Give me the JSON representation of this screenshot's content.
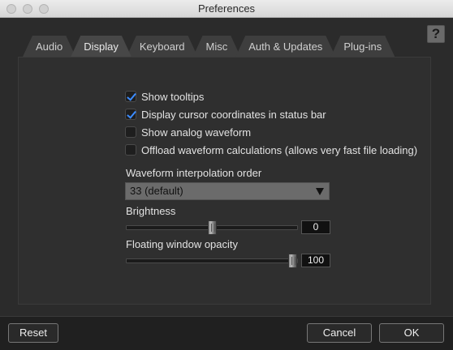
{
  "window": {
    "title": "Preferences"
  },
  "help": {
    "label": "?"
  },
  "tabs": [
    {
      "label": "Audio"
    },
    {
      "label": "Display"
    },
    {
      "label": "Keyboard"
    },
    {
      "label": "Misc"
    },
    {
      "label": "Auth & Updates"
    },
    {
      "label": "Plug-ins"
    }
  ],
  "active_tab": "Display",
  "display": {
    "checkboxes": [
      {
        "label": "Show tooltips",
        "checked": true
      },
      {
        "label": "Display cursor coordinates in status bar",
        "checked": true
      },
      {
        "label": "Show analog waveform",
        "checked": false
      },
      {
        "label": "Offload waveform calculations (allows very fast file loading)",
        "checked": false
      }
    ],
    "interpolation": {
      "label": "Waveform interpolation order",
      "value": "33 (default)"
    },
    "brightness": {
      "label": "Brightness",
      "value": "0",
      "level": 0.5
    },
    "opacity": {
      "label": "Floating window opacity",
      "value": "100",
      "level": 1.0
    }
  },
  "footer": {
    "reset_label": "Reset",
    "cancel_label": "Cancel",
    "ok_label": "OK"
  },
  "colors": {
    "accent": "#3c8cff",
    "background": "#2b2b2b"
  }
}
